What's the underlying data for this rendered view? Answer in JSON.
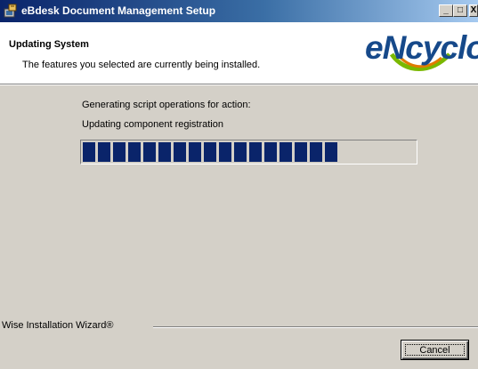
{
  "window": {
    "title": "eBdesk Document Management Setup",
    "controls": {
      "minimize": "_",
      "maximize": "□",
      "close": "X"
    }
  },
  "header": {
    "title": "Updating System",
    "subtitle": "The features you selected are currently being installed.",
    "logo_text": "eNcyclo"
  },
  "status": {
    "line1": "Generating script operations for action:",
    "line2": "Updating component registration"
  },
  "progress": {
    "percent": 78
  },
  "footer": {
    "branding": "Wise Installation Wizard®",
    "cancel_label": "Cancel"
  },
  "colors": {
    "titlebar_start": "#0a246a",
    "titlebar_end": "#a6caf0",
    "progress_block": "#0a246a",
    "logo_blue": "#16498a",
    "logo_green": "#7ab800",
    "logo_orange": "#e07b00"
  },
  "icons": {
    "app": "installer-icon"
  }
}
